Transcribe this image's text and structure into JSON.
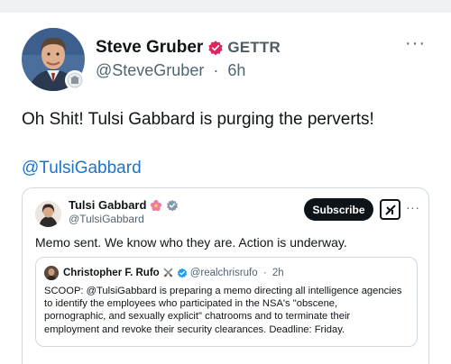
{
  "post": {
    "author_name": "Steve Gruber",
    "network_tag": "GETTR",
    "handle": "@SteveGruber",
    "separator": "·",
    "time": "6h",
    "more_label": "···",
    "text": "Oh Shit! Tulsi Gabbard is purging the perverts!",
    "mention": "@TulsiGabbard"
  },
  "embed": {
    "author_name": "Tulsi Gabbard",
    "handle": "@TulsiGabbard",
    "subscribe_label": "Subscribe",
    "more_label": "···",
    "text": "Memo sent.  We know who they are.  Action is underway.",
    "quote": {
      "author_name": "Christopher F. Rufo",
      "handle": "@realchrisrufo",
      "separator": "·",
      "time": "2h",
      "lines": [
        "SCOOP: @TulsiGabbard is preparing a memo directing all intelligence agencies",
        "to identify the employees who participated in the NSA's \"obscene,",
        "pornographic, and sexually explicit\" chatrooms and to terminate their",
        "employment and revoke their security clearances. Deadline: Friday."
      ]
    }
  },
  "icons": {
    "verified": "red-verified-badge-icon",
    "embed_emoji": "pink-flower-emoji-icon",
    "embed_verified": "grey-verified-badge-icon",
    "quote_emoji": "crossed-swords-emoji-icon",
    "quote_verified": "blue-verified-badge-icon",
    "grok": "grok-icon"
  },
  "colors": {
    "verified_red": "#e0245e",
    "mention_blue": "#1d74c6",
    "handle_grey": "#536471",
    "border": "#cfd9de",
    "quote_verified_blue": "#1d9bf0"
  }
}
